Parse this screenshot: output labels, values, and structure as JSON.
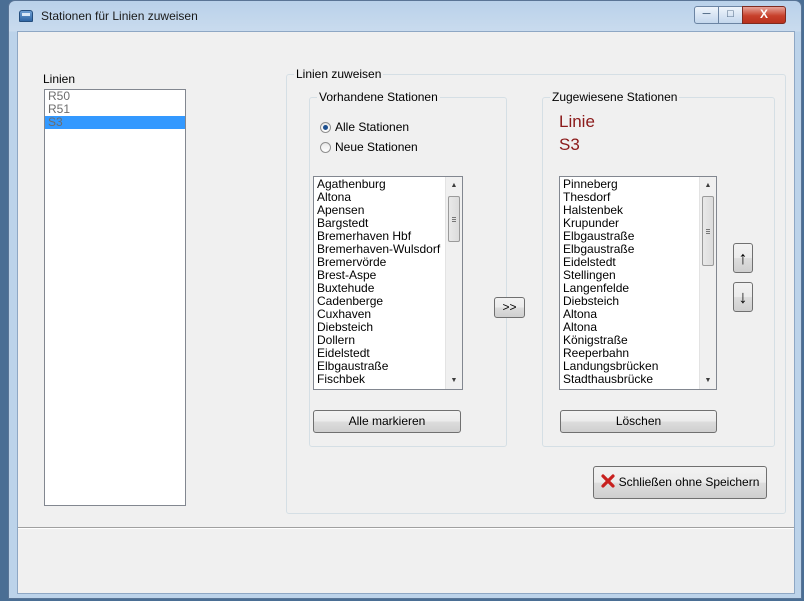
{
  "window": {
    "title": "Stationen für Linien zuweisen",
    "icon": "bus-icon",
    "controls": {
      "minimize": "─",
      "maximize": "□",
      "close": "X"
    }
  },
  "lines_panel": {
    "label": "Linien",
    "items": [
      "R50",
      "R51",
      "S3"
    ],
    "selected": "S3"
  },
  "assign_group": {
    "legend": "Linien zuweisen",
    "available": {
      "legend": "Vorhandene Stationen",
      "radio_all": "Alle Stationen",
      "radio_new": "Neue Stationen",
      "radio_selected": "Alle Stationen",
      "items": [
        "Agathenburg",
        "Altona",
        "Apensen",
        "Bargstedt",
        "Bremerhaven Hbf",
        "Bremerhaven-Wulsdorf",
        "Bremervörde",
        "Brest-Aspe",
        "Buxtehude",
        "Cadenberge",
        "Cuxhaven",
        "Diebsteich",
        "Dollern",
        "Eidelstedt",
        "Elbgaustraße",
        "Fischbek"
      ],
      "mark_all_button": "Alle markieren"
    },
    "transfer_button": ">>",
    "assigned": {
      "legend": "Zugewiesene Stationen",
      "line_heading": "Linie",
      "line_name": "S3",
      "items": [
        "Pinneberg",
        "Thesdorf",
        "Halstenbek",
        "Krupunder",
        "Elbgaustraße",
        "Elbgaustraße",
        "Eidelstedt",
        "Stellingen",
        "Langenfelde",
        "Diebsteich",
        "Altona",
        "Altona",
        "Königstraße",
        "Reeperbahn",
        "Landungsbrücken",
        "Stadthausbrücke"
      ],
      "delete_button": "Löschen",
      "move_up": "↑",
      "move_down": "↓"
    },
    "close_button": "Schließen ohne Speichern"
  },
  "colors": {
    "selection": "#3399ff",
    "line_label": "#8b1a1a",
    "close_icon": "#c8201e"
  }
}
